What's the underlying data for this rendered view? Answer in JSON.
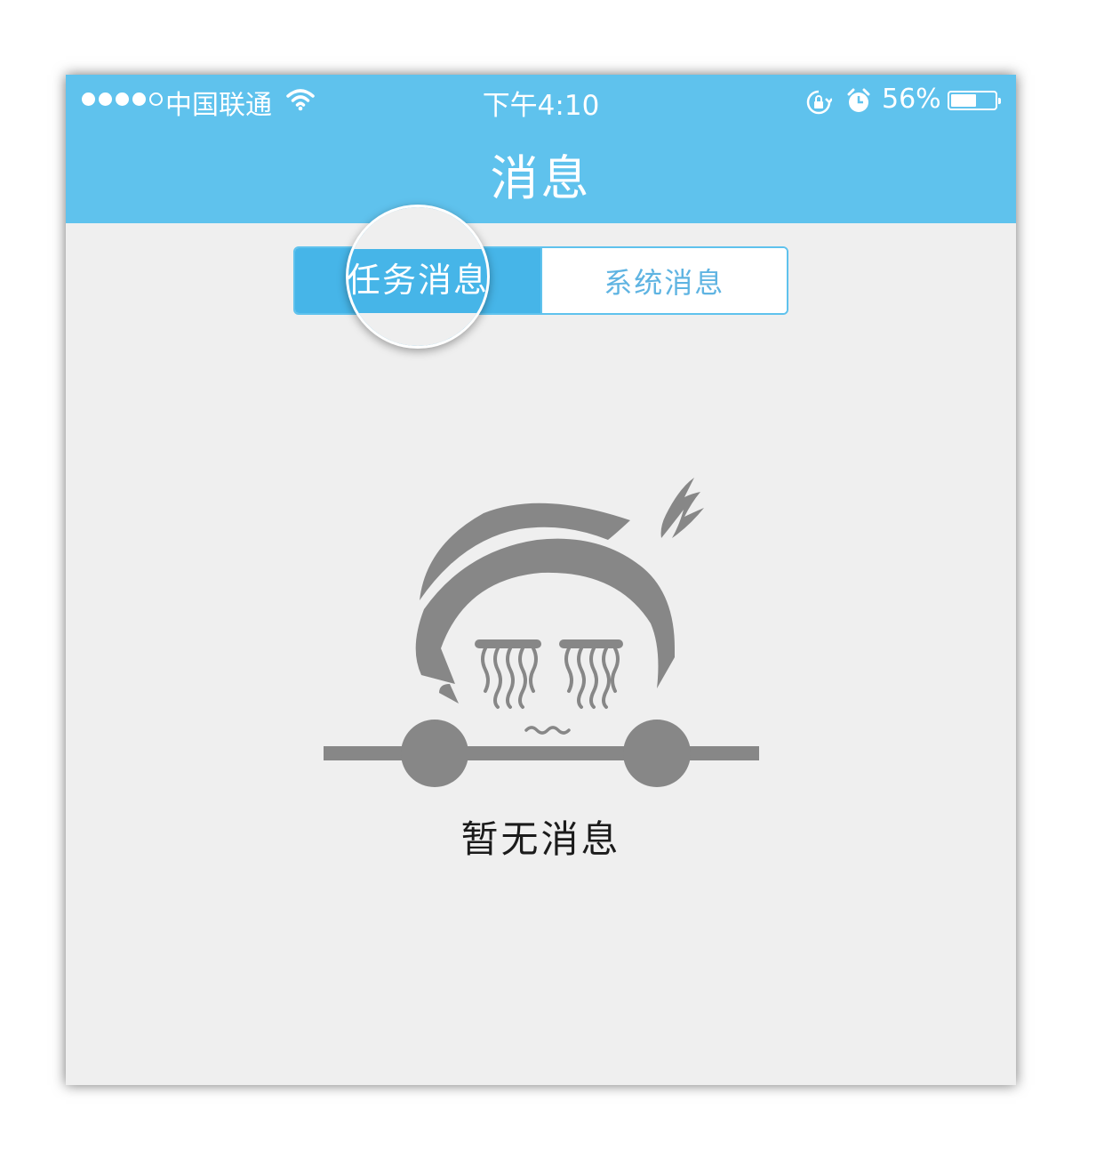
{
  "status_bar": {
    "carrier": "中国联通",
    "time": "下午4:10",
    "battery_percent": "56%",
    "battery_level": 0.56,
    "signal_bars_filled": 4,
    "signal_bars_total": 5
  },
  "header": {
    "title": "消息"
  },
  "tabs": [
    {
      "label": "任务消息",
      "selected": true
    },
    {
      "label": "系统消息",
      "selected": false
    }
  ],
  "empty_state": {
    "text": "暂无消息"
  },
  "colors": {
    "accent": "#5fc2ed",
    "active_tab": "#46b5e8",
    "background": "#efefef",
    "illustration": "#878787"
  }
}
